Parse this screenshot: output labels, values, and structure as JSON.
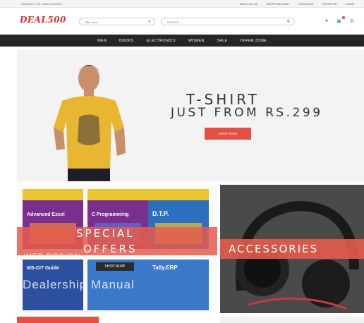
{
  "topbar": {
    "contact": "CONTACT US: 1800-XXXXXX",
    "links": [
      "WISH LIST (0)",
      "SHOPPING CART",
      "CHECKOUT",
      "REGISTER",
      "LOGIN"
    ]
  },
  "header": {
    "logo": "DEAL500",
    "offer_select": "Offer zone",
    "search_placeholder": "SEARCH...",
    "cart_count": "0"
  },
  "nav": {
    "items": [
      "MEN",
      "BOOKS",
      "ELECTRONICS",
      "WOMEN",
      "SALE",
      "OFFER ZONE"
    ]
  },
  "hero": {
    "line1": "T-SHIRT",
    "line2": "JUST FROM RS.299",
    "button": "SHOP NOW!"
  },
  "promo_left": {
    "line1": "SPECIAL",
    "line2": "OFFERS",
    "button": "SHOP NOW!",
    "books": [
      "Advanced Excel",
      "C Programming",
      "D.T.P.",
      "MS-CIT Guide",
      "Tally.ERP"
    ],
    "watermark1": "WEB DESIGN",
    "watermark2": "Dealership Manual"
  },
  "promo_right": {
    "label": "ACCESSORIES"
  },
  "colors": {
    "accent": "#e55044",
    "nav_bg": "#262626",
    "logo": "#d62f2f",
    "icon": "#3a8fc7"
  }
}
